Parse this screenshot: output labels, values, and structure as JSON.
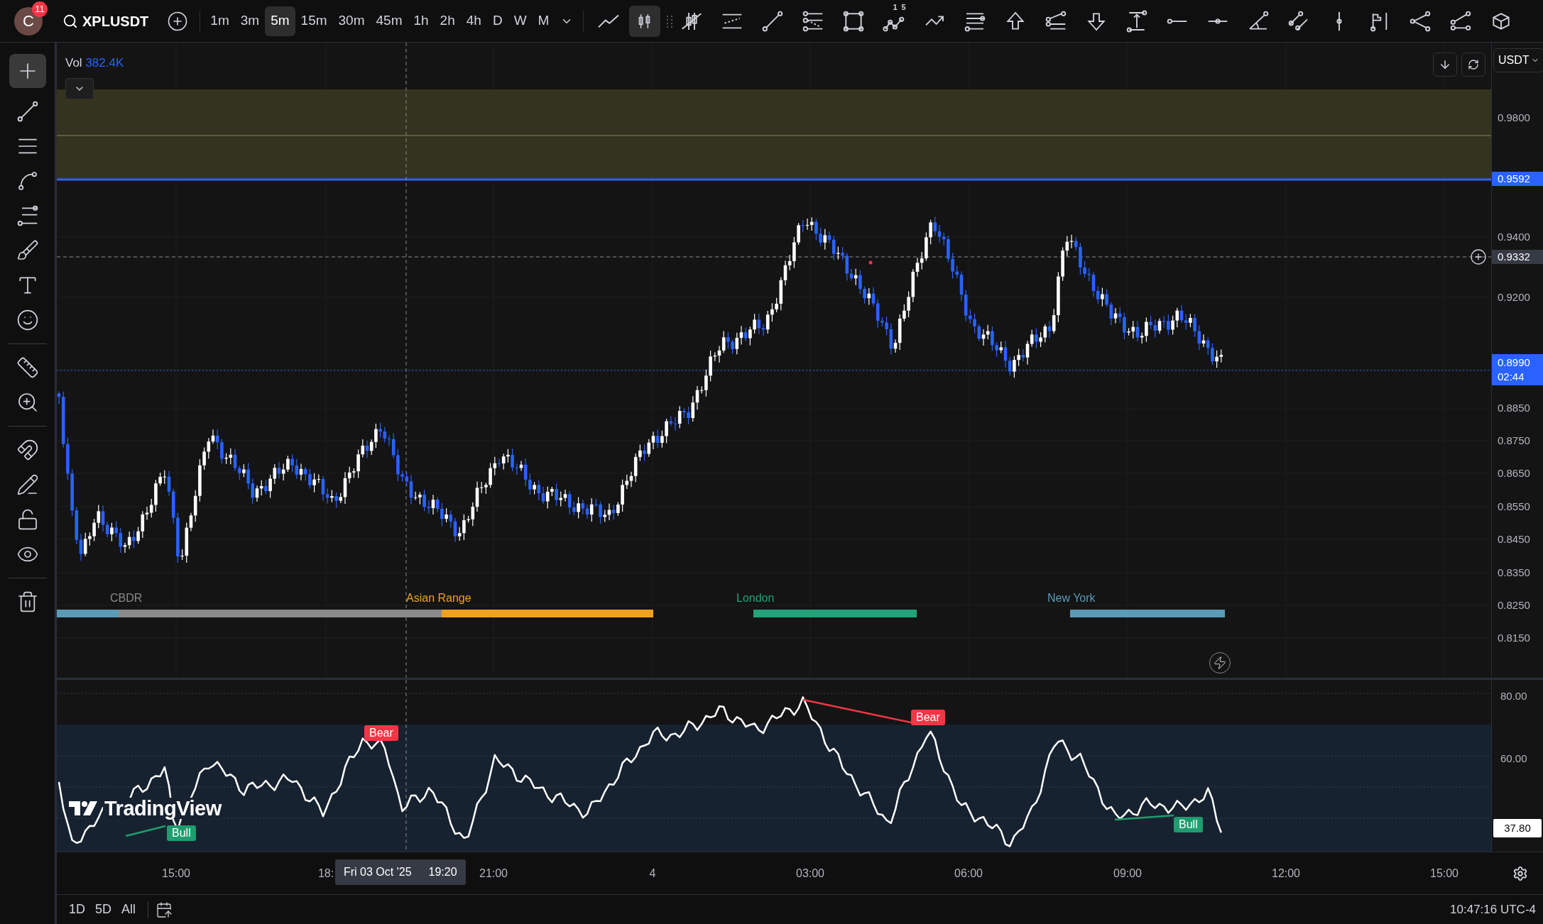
{
  "top_bar": {
    "avatar_letter": "C",
    "notification_count": "11",
    "symbol": "XPLUSDT",
    "intervals": [
      {
        "label": "1m",
        "selected": false
      },
      {
        "label": "3m",
        "selected": false
      },
      {
        "label": "5m",
        "selected": true
      },
      {
        "label": "15m",
        "selected": false
      },
      {
        "label": "30m",
        "selected": false
      },
      {
        "label": "45m",
        "selected": false
      },
      {
        "label": "1h",
        "selected": false
      },
      {
        "label": "2h",
        "selected": false
      },
      {
        "label": "4h",
        "selected": false
      },
      {
        "label": "D",
        "selected": false
      },
      {
        "label": "W",
        "selected": false
      },
      {
        "label": "M",
        "selected": false
      }
    ],
    "wave_tool_labels": [
      "1",
      "5"
    ]
  },
  "chart": {
    "volume_label": "Vol",
    "volume_value": "382.4K",
    "currency": "USDT",
    "price_labels": [
      {
        "text": "0.9800",
        "kind": "tick"
      },
      {
        "text": "0.9592",
        "kind": "line"
      },
      {
        "text": "0.9400",
        "kind": "tick"
      },
      {
        "text": "0.9332",
        "kind": "crosshair"
      },
      {
        "text": "0.9200",
        "kind": "tick"
      },
      {
        "text": "0.8990",
        "kind": "last",
        "countdown": "02:44"
      },
      {
        "text": "0.8850",
        "kind": "tick"
      },
      {
        "text": "0.8750",
        "kind": "tick"
      },
      {
        "text": "0.8650",
        "kind": "tick"
      },
      {
        "text": "0.8550",
        "kind": "tick"
      },
      {
        "text": "0.8450",
        "kind": "tick"
      },
      {
        "text": "0.8350",
        "kind": "tick"
      },
      {
        "text": "0.8250",
        "kind": "tick"
      },
      {
        "text": "0.8150",
        "kind": "tick"
      }
    ],
    "sessions": [
      {
        "label": "CBDR",
        "color": "#8a8a8a"
      },
      {
        "label": "Asian Range",
        "color": "#f0a21f"
      },
      {
        "label": "London",
        "color": "#22a37a"
      },
      {
        "label": "New York",
        "color": "#5a9bb6"
      }
    ]
  },
  "rsi": {
    "price_labels": [
      "80.00",
      "60.00"
    ],
    "current": "37.80",
    "signals": [
      {
        "label": "Bear",
        "kind": "bear"
      },
      {
        "label": "Bull",
        "kind": "bull"
      },
      {
        "label": "Bear",
        "kind": "bear"
      },
      {
        "label": "Bull",
        "kind": "bull"
      }
    ],
    "logo": "TradingView"
  },
  "time_axis": {
    "labels": [
      "15:00",
      "18:",
      "21:00",
      "4",
      "03:00",
      "06:00",
      "09:00",
      "12:00",
      "15:00"
    ],
    "crosshair_date": "Fri 03 Oct '25",
    "crosshair_time": "19:20"
  },
  "bottom_bar": {
    "ranges": [
      "1D",
      "5D",
      "All"
    ],
    "clock": "10:47:16 UTC-4"
  }
}
